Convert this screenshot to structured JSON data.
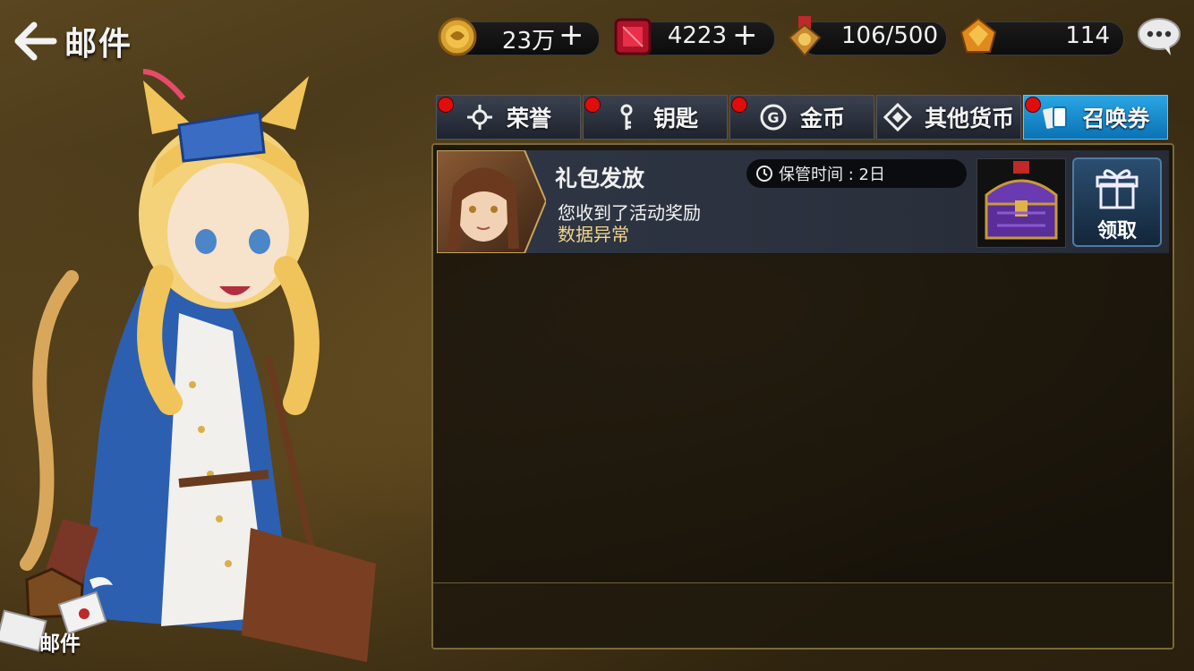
{
  "header": {
    "title": "邮件"
  },
  "currencies": [
    {
      "name": "coin",
      "icon": "coin-icon",
      "value": "23万",
      "has_plus": true
    },
    {
      "name": "gem",
      "icon": "ruby-gem-icon",
      "value": "4223",
      "has_plus": true
    },
    {
      "name": "medal",
      "icon": "medal-icon",
      "value": "106/500",
      "has_plus": false
    },
    {
      "name": "amber",
      "icon": "amber-crystal-icon",
      "value": "114",
      "has_plus": false
    }
  ],
  "plus_symbol": "+",
  "tabs": [
    {
      "label": "荣誉",
      "icon": "honor-icon",
      "badge": true,
      "active": false
    },
    {
      "label": "钥匙",
      "icon": "key-icon",
      "badge": true,
      "active": false
    },
    {
      "label": "金币",
      "icon": "gold-coin-icon",
      "badge": true,
      "active": false
    },
    {
      "label": "其他货币",
      "icon": "other-currency-icon",
      "badge": false,
      "active": false
    },
    {
      "label": "召唤券",
      "icon": "summon-ticket-icon",
      "badge": true,
      "active": true
    }
  ],
  "mails": [
    {
      "title": "礼包发放",
      "line1": "您收到了活动奖励",
      "line2": "数据异常",
      "keep_time": "保管时间 : 2日",
      "reward_icon": "treasure-chest-icon",
      "claim_label": "领取"
    }
  ],
  "mailbox": {
    "label": "邮件"
  },
  "colors": {
    "active_tab": "#1a8fd4",
    "badge": "#e00d0d",
    "highlight_text": "#f0d58a"
  }
}
